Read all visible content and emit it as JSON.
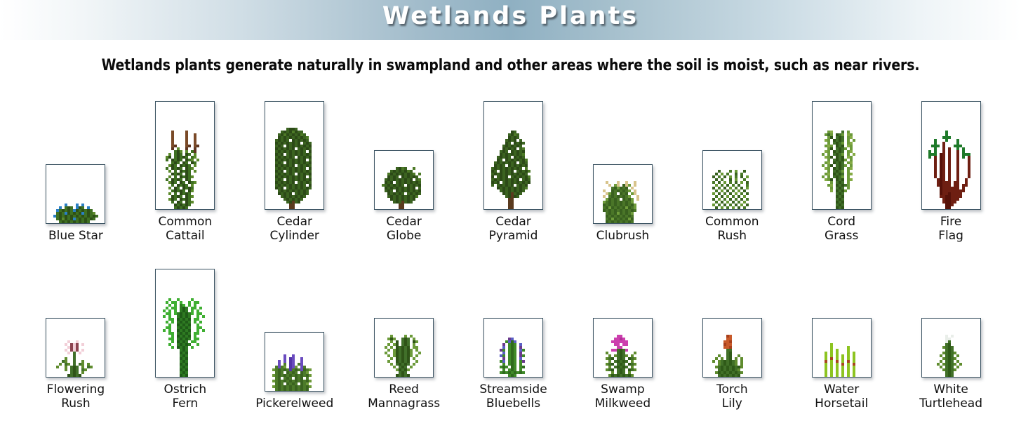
{
  "header": {
    "title": "Wetlands Plants",
    "gradient_edge_color": "#ffffff",
    "gradient_center_color": "#8fb0c2",
    "title_color": "#ffffff"
  },
  "subtitle": "Wetlands plants generate naturally in swampland and other areas where the soil is moist, such as near rivers.",
  "palette": {
    "card_border": "#3c5463",
    "card_background": "#ffffff",
    "label_color": "#111111",
    "dark_green": "#2d5016",
    "mid_green": "#3f7022",
    "light_green": "#6f9c3b",
    "bright_green": "#3faf32",
    "blue_flower": "#2a7fc4",
    "brown": "#7a4a28",
    "maroon": "#6e1f12",
    "tan": "#d8c48c",
    "purple": "#6a4bbf",
    "magenta": "#cc3fae",
    "orange": "#c85a2a",
    "pale_pink": "#f2cfd8",
    "yellow_green": "#8dc421",
    "white_bud": "#e9eee9"
  },
  "rows": [
    {
      "name": "row-top",
      "plants": [
        {
          "label": "Blue Star",
          "card": "sq",
          "sprite": "blue-star"
        },
        {
          "label": "Common\nCattail",
          "card": "tall",
          "sprite": "common-cattail"
        },
        {
          "label": "Cedar\nCylinder",
          "card": "tall",
          "sprite": "cedar-cylinder"
        },
        {
          "label": "Cedar\nGlobe",
          "card": "sq",
          "sprite": "cedar-globe"
        },
        {
          "label": "Cedar\nPyramid",
          "card": "tall",
          "sprite": "cedar-pyramid"
        },
        {
          "label": "Clubrush",
          "card": "sq",
          "sprite": "clubrush"
        },
        {
          "label": "Common\nRush",
          "card": "sq",
          "sprite": "common-rush"
        },
        {
          "label": "Cord\nGrass",
          "card": "tall",
          "sprite": "cord-grass"
        },
        {
          "label": "Fire\nFlag",
          "card": "tall",
          "sprite": "fire-flag"
        }
      ]
    },
    {
      "name": "row-bottom",
      "plants": [
        {
          "label": "Flowering\nRush",
          "card": "sq",
          "sprite": "flowering-rush"
        },
        {
          "label": "Ostrich\nFern",
          "card": "tall",
          "sprite": "ostrich-fern"
        },
        {
          "label": "Pickerelweed",
          "card": "sq",
          "sprite": "pickerelweed"
        },
        {
          "label": "Reed\nMannagrass",
          "card": "sq",
          "sprite": "reed-mannagrass"
        },
        {
          "label": "Streamside\nBluebells",
          "card": "sq",
          "sprite": "streamside-bluebells"
        },
        {
          "label": "Swamp\nMilkweed",
          "card": "sq",
          "sprite": "swamp-milkweed"
        },
        {
          "label": "Torch\nLily",
          "card": "sq",
          "sprite": "torch-lily"
        },
        {
          "label": "Water\nHorsetail",
          "card": "sq",
          "sprite": "water-horsetail"
        },
        {
          "label": "White\nTurtlehead",
          "card": "sq",
          "sprite": "white-turtlehead"
        }
      ]
    }
  ],
  "sprites": {
    "blue-star": {
      "cols": 16,
      "rows": 16,
      "cell": 4,
      "legend": {
        "d": "#2d5016",
        "m": "#3f7022",
        "l": "#5c8a2c",
        "b": "#2a7fc4",
        "c": "#3f9ad6"
      },
      "pix": [
        "................",
        "................",
        "................",
        "................",
        "................",
        "................",
        "................",
        "................",
        "................",
        "....b...b.b.....",
        "..b.mdm.bdm.b...",
        ".bmdmdmbdmdmdm..",
        ".mdmbdmdmdbmdml.",
        "bmdmdmdmdmdmdmdm",
        ".mdldmdbmdmdmdm.",
        "..mdmdmdmdmdm..."
      ]
    },
    "cedar-cylinder": {
      "cols": 16,
      "rows": 30,
      "cell": 4,
      "legend": {
        "d": "#2c4a17",
        "m": "#3b6320",
        "l": "#4d7a27",
        "t": "#5a3a1e"
      },
      "pix": [
        "................",
        ".....mddm.......",
        "...mdmdldmm.....",
        "..mdldmdmdlm....",
        "..dmdmdmdmdml...",
        ".mdmdm.dmdmdm...",
        ".dmdmdmdmd.mdm..",
        ".mdm.dmdmdmdmd..",
        ".dmdmdmd.mdmdm..",
        ".mdmdmdmdmdm.d..",
        ".dmd.mdmdmdmdm..",
        ".mdmdmdm.dmdmd..",
        ".dmdmdmdmdmd.m..",
        ".mdm.dmdmdmdmd..",
        ".dmdmdmd.mdmdm..",
        ".mdmdmdmdmdm.d..",
        ".dmd.mdmdmdmdm..",
        ".mdmdmdm.dmdmd..",
        ".dmdmdmdmdmd.m..",
        ".mdm.dmdmdmdmd..",
        ".dmdmdmd.mdmdm..",
        ".mdmdmdmdmdm.d..",
        ".dmd.mdmdmdmdm..",
        "..mdmdmdmdmdm...",
        "..dmdmd.mdmdm...",
        "...mdmdmdmdm....",
        "....mdmdmdm.....",
        ".....mdtmd......",
        "......tt........",
        "......tt........"
      ]
    },
    "cedar-globe": {
      "cols": 16,
      "rows": 16,
      "cell": 4,
      "legend": {
        "d": "#2c4a17",
        "m": "#3b6320",
        "l": "#4d7a27",
        "t": "#5a3a1e"
      },
      "pix": [
        "................",
        ".....mdlm..l....",
        "...mdmdmdlm.....",
        "..ldmdmdmdml.l..",
        "..dmdm.dmdmdm...",
        ".mdmdmdmdmd.ml..",
        ".dmd.mdmdmdmdm..",
        "lmdmdmdm.dmdmd..",
        ".dmdmdmdmdmd.m..",
        ".mdm.dmdmdmdmd..",
        "..dmdmdm.mdmdm..",
        "..mdmdmdmdmdl...",
        "...dmdmdmdmd....",
        "....mdmtmdm.....",
        "......tt........",
        "......tt........"
      ]
    },
    "cedar-pyramid": {
      "cols": 16,
      "rows": 30,
      "cell": 4,
      "legend": {
        "d": "#2c4a17",
        "m": "#3b6320",
        "l": "#4d7a27",
        "t": "#5a3a1e"
      },
      "pix": [
        "................",
        "................",
        ".......dm.......",
        "......mdlm......",
        "......dmdm......",
        ".....mdmd.m.....",
        ".....dm.dmdm....",
        "....mdmdmdm.....",
        "....dmdmd.ml....",
        "...mdm.dmdmd....",
        "...dmdmdmdml....",
        "..mdmdm.dmdm....",
        "..dm.dmdmdmdl...",
        ".mdmdmdmd.mdm...",
        ".dmdm.dmdmdmd...",
        "mdmdmdmdmdm.l...",
        "dm.dmdmd.mdmdl..",
        "mdmdmdmdmdmdm...",
        "d.mdmd.mdmdmdl..",
        "mdmdmdmdmd.mdm..",
        "dmd.mdmdmdmdmd..",
        "m.mdmdmd.mdmd...",
        "..dmdmdmdmdml...",
        "...mdmdmdmdm....",
        "....dmdtmdm.....",
        ".....mdtdm......",
        "......tt........",
        "......tt........",
        "......tt........",
        "......tt........"
      ]
    },
    "common-cattail": {
      "cols": 16,
      "rows": 30,
      "cell": 4,
      "legend": {
        "d": "#2c4a17",
        "m": "#3f7022",
        "l": "#5c8a2c",
        "b": "#7a4a28",
        "k": "#5e3520"
      },
      "pix": [
        "................",
        "................",
        "...b....b.......",
        "...b....b..b....",
        "...b....b..b....",
        "...b....b..b....",
        "...b....b..b....",
        "...bk...bk.bk...",
        "...k.l..k..k....",
        "....mdl.l.mk....",
        "..l.mdm.dm.l....",
        ".ld.mdmdm.ml....",
        ".m.dmdm.dml.l...",
        "...mdm.dm.dm....",
        "..ldm.dmdm.l....",
        ".m.dmdm.dml.....",
        "..l.m.dmdm.l....",
        "...dmdm.dm......",
        "..l.m.dmdml.....",
        ".m.dmdm.dm......",
        "..ldm.dm.dml....",
        "...m.dmdm.l.....",
        "..l.dm.dmdm.....",
        "...mdmdm.dl.....",
        "..l.m.dmdm......",
        "...dmdm.dml.....",
        "..ldm.dmdm......",
        "...m.dm.dml.....",
        "....dmdmdm......",
        "....mdmdm......."
      ]
    },
    "clubrush": {
      "cols": 16,
      "rows": 16,
      "cell": 4,
      "legend": {
        "d": "#39601f",
        "m": "#4a7528",
        "l": "#6f9c3b",
        "t": "#d8c48c"
      },
      "pix": [
        "................",
        "..t...t..t..t...",
        "...t.lt.dtl.t...",
        "....mdldmd.t....",
        ".t..dmdmdml.t...",
        "..tldm.dmd.lt...",
        ".t.mdmdmdml..t..",
        "..ldmdm.dmdl.t..",
        ".lmdmdmdmdml....",
        ".dmdmdmdmdmdl...",
        ".mdldmdmdldml...",
        ".dmdmdmdmdmdm...",
        "..mdmdldmdml....",
        "..dmdmdmdmdm....",
        "..mdldmdmdld....",
        "..dmdmdmdmdm...."
      ]
    },
    "common-rush": {
      "cols": 16,
      "rows": 16,
      "cell": 4,
      "legend": {
        "d": "#3a6320",
        "m": "#4a7a28",
        "l": "#6a9a36"
      },
      "pix": [
        "................",
        "................",
        "...d...m.l..d...",
        "..d.l.m..d.m....",
        ".d.m.d.l.m.d.l..",
        "..d.m..d.l..m...",
        ".m.d.l.m.d.l.d..",
        "..l.m.d.m.d..m..",
        ".d.m.d.l.m.d.l..",
        "..m.l.d.m.l.d...",
        ".l.d.m.d.l.m.d..",
        "..m.d.l.m.d.l...",
        ".d.l.m.d.m.d.m..",
        "..m.d.l.d.m.l...",
        ".l.m.d.m.d.l.d..",
        "..d.l.m.l.d.m..."
      ]
    },
    "cord-grass": {
      "cols": 16,
      "rows": 30,
      "cell": 4,
      "legend": {
        "d": "#2f5418",
        "m": "#41702a",
        "l": "#6c9a3a",
        "y": "#85ab45"
      },
      "pix": [
        "................",
        "................",
        "...ly...m.l.....",
        "..lml.dml.yl....",
        "...ld.mdm.ly....",
        "..yl.dmdm.l.l...",
        "...l.mdml.ly....",
        "..lyl.dmd.yl....",
        "...ld.mdml.l....",
        "..yl.dmdm.ly....",
        ".l.l.mdml.l.y...",
        "..yld.dmd.yl....",
        "...l.mdmdl.l....",
        "..ly.dmdm.ly....",
        ".l.ld.mdml.l....",
        "..yl.dmdm.ly....",
        "...l.mdml.l.....",
        "..ly.dmdm.ly....",
        ".l.l.mdml.l.....",
        "..yld.dmd.ly....",
        "....l.mdm.l.....",
        "...ly.dmdml.....",
        "....l.mdm.l.....",
        "....y.dmdl......",
        "......mdm.......",
        "......dmd.......",
        "......mdm.......",
        "......dmd.......",
        "......mdm.......",
        "......dmd......."
      ]
    },
    "fire-flag": {
      "cols": 16,
      "rows": 30,
      "cell": 4,
      "legend": {
        "r": "#6e1f12",
        "k": "#561209",
        "g": "#1f7a2a",
        "e": "#2a8f34"
      },
      "pix": [
        "................",
        "................",
        "......g.........",
        "......g.........",
        ".....ggg........",
        "..g...g...g.....",
        "..g..r....g.....",
        ".ggg.r...ggg....",
        "..g..r.r..g.g...",
        "g.g..r.r..r.g...",
        "ggg.kr.r..r.ggg.",
        "g.r.kr.r..r.g.r.",
        "..r.kr.r..r...r.",
        "..r.kr.r..r...r.",
        "..r.kr.r..r...r.",
        "..r.kr.r..r...r.",
        "..r.kr.r..r...r.",
        "..r.kr.r..r...r.",
        "..r.kr.r..r...r.",
        "...rkr.r..r..r..",
        "...rkrrr.rr..r..",
        "...rkrrr.rr.rr..",
        "....krrrrrr.r...",
        "....krrrrrrrr...",
        "....krrkrrrr....",
        "....rrkkrrrr....",
        ".....rkkrrr.....",
        ".....rkkrr......",
        "......kkr.......",
        "......kk........"
      ]
    },
    "flowering-rush": {
      "cols": 16,
      "rows": 16,
      "cell": 4,
      "legend": {
        "d": "#2f5418",
        "m": "#41702a",
        "l": "#5f8c2e",
        "p": "#f2cfd8",
        "r": "#8c4450"
      },
      "pix": [
        "................",
        "................",
        "................",
        ".....p..p.......",
        "....p.rpr.p.....",
        ".....prpr.......",
        "....p.rpr.p.....",
        ".....p.m.p......",
        ".......m........",
        "....l..m........",
        "...ml..m..l.....",
        "..l.ml.m.ml.l...",
        ".l..l.mdm.l.ml..",
        "....l.mdm.ml....",
        "......mdm.l.....",
        ".....dmdmd......"
      ]
    },
    "ostrich-fern": {
      "cols": 16,
      "rows": 30,
      "cell": 4,
      "legend": {
        "d": "#1f5b18",
        "m": "#2e7a22",
        "l": "#3faf32",
        "y": "#54c244"
      },
      "pix": [
        "................",
        "................",
        "..l..l....l.....",
        ".l.ll.l..l.ll...",
        "..l.l.ml.l.l....",
        ".l.ll.mdm.ll.l..",
        "l.l.l.mdm.l.l...",
        ".ll.lmdmdml.ll..",
        "l.l..mdmdm..l.l.",
        "..ll.dmdmd.ll...",
        ".l.l.mdmdm.l.l..",
        "..l..dmdmd..l...",
        ".ll..mdmdm..ll..",
        "l.l..dmdmd..l.l.",
        "..ll.mdmdm.ll...",
        "...l.dmdmd.l....",
        "..ll.mdmdm.ll...",
        "...l.dmdm.ll....",
        "..l..mdmdm..l...",
        "...l.dmdm.l.....",
        "......mdm.......",
        "......dmd.......",
        "......mdm.......",
        "......dmd.......",
        "......mdm.......",
        "......dmd.......",
        "......mdm.......",
        "......dmd.......",
        "......mdm.......",
        "......dmd......."
      ]
    },
    "pickerelweed": {
      "cols": 16,
      "rows": 16,
      "cell": 4,
      "legend": {
        "d": "#3a6320",
        "m": "#4c7a2a",
        "l": "#6d9a38",
        "p": "#6a4bbf",
        "v": "#5335a8"
      },
      "pix": [
        "................",
        "................",
        "................",
        "....p..p........",
        "....p.vp..p.....",
        "..p.p.vp..p.....",
        "..p.m.vp.mp.....",
        ".mpml.vpl.pm....",
        "lmdmdmvmdmpdml..",
        ".mdm.dmdm.dml...",
        "lmdmdmdmdmdmdl..",
        ".md.mdm.dmd.m...",
        "lmdmdmdmdmdmdl..",
        ".mdm.dmdm.dml...",
        "lmdmdmdmdmdmdl..",
        ".mdmdmdmdmdmd..."
      ]
    },
    "reed-mannagrass": {
      "cols": 16,
      "rows": 16,
      "cell": 4,
      "legend": {
        "d": "#2f5418",
        "m": "#41702a",
        "l": "#6c9a3a"
      },
      "pix": [
        "................",
        "...l....l.l.....",
        "..ldl..mdm.l....",
        "...l.d.mdm.dl...",
        "..l.ld.mdm.l....",
        ".l.l.dmdmd.ll...",
        "..l.ldmdmdl.l...",
        ".l..ldmdmdl..l..",
        "..l.ldmdmdl.l...",
        "...l.dmdmd.l....",
        "..l..dmdmd..l...",
        "...l.mdmdm.l....",
        "....l.mdm.l.....",
        ".....ldmdl......",
        "......mdm.......",
        ".....dmdmd......"
      ]
    },
    "streamside-bluebells": {
      "cols": 16,
      "rows": 16,
      "cell": 4,
      "legend": {
        "d": "#2f6a1e",
        "m": "#3f8a28",
        "b": "#5a5ec4",
        "v": "#6a3a8c"
      },
      "pix": [
        "................",
        "................",
        "......vb........",
        ".....mbdb.......",
        "....v.mdm.b.....",
        "....b.mdm.v.....",
        "...vm.mdm.bm....",
        "....b.mdm.v.....",
        "...bm.mdm.vm....",
        "....v.mdm.b.....",
        "...mb.mdm.mv....",
        "....m.mdm.m.....",
        "...mdm.dm.md....",
        "....m.mdm.m.....",
        "...mdmdmdmdm....",
        "......mdm......."
      ]
    },
    "swamp-milkweed": {
      "cols": 16,
      "rows": 16,
      "cell": 4,
      "legend": {
        "d": "#2f5a18",
        "m": "#417028",
        "l": "#5f8c2e",
        "p": "#cc3fae",
        "q": "#b02f96"
      },
      "pix": [
        "................",
        "......pp........",
        ".....ppqp.......",
        "....pppppp......",
        ".....pp.pp......",
        "......pp........",
        "....ppmdmp......",
        "..l...mdm...l...",
        "...l.lmdml.l....",
        "..lmd.mdm.dml...",
        "...l.mdmdm.l....",
        "..lmd.mdm.dml...",
        "...l.mdmdm.l....",
        "..lmd.mdm.dml...",
        "....l.mdm.l.....",
        "...ldmdmdmdl...."
      ]
    },
    "torch-lily": {
      "cols": 16,
      "rows": 16,
      "cell": 4,
      "legend": {
        "d": "#2f5a18",
        "m": "#417028",
        "l": "#5f8c2e",
        "o": "#c85a2a",
        "r": "#a8401c"
      },
      "pix": [
        "................",
        "......ro........",
        "......oo........",
        ".....oor........",
        ".....roo........",
        ".....oor........",
        "......mm........",
        "......md........",
        "...l..md..l.....",
        "..l.l.md.l.l....",
        ".l.lmdmdml.l....",
        "...lmdmdml.l....",
        "..lmdmdmdmdl....",
        "...mdmdmdml.....",
        "..ldmdmdmdml....",
        "...mdmdmdmd....."
      ]
    },
    "water-horsetail": {
      "cols": 16,
      "rows": 16,
      "cell": 4,
      "legend": {
        "g": "#8dc421",
        "y": "#9ed42c",
        "r": "#a8461c",
        "k": "#7a3414"
      },
      "pix": [
        "................",
        "................",
        "................",
        "................",
        "....g...........",
        "....g.....g.....",
        "....g.g...g.....",
        "..g.g.g...g.g...",
        "..g.g.g.g.g.g...",
        "..g.r.g.g.g.g...",
        "..r.g.r.g.r.g...",
        "..g.g.g.r.g.r...",
        "..g.g.g.g.g.g...",
        "..g.g.g.g.g.g...",
        "..g.g.g.g.g.g...",
        "..g.g.g.g.g.g..."
      ]
    },
    "white-turtlehead": {
      "cols": 16,
      "rows": 16,
      "cell": 4,
      "legend": {
        "d": "#2f5a18",
        "m": "#417028",
        "l": "#5f8c2e",
        "w": "#e9eee9"
      },
      "pix": [
        "................",
        "......w.w.......",
        "......ww........",
        "......wm........",
        "......md........",
        ".....lmdm.......",
        "......mdm.......",
        ".....lmdml......",
        "....l.mdm.l.....",
        ".....lmdml......",
        "....l.mdm.l.....",
        "...l.lmdml.l....",
        "....l.mdm.l.....",
        ".....lmdml......",
        "......mdm.......",
        "......mdm......."
      ]
    }
  }
}
